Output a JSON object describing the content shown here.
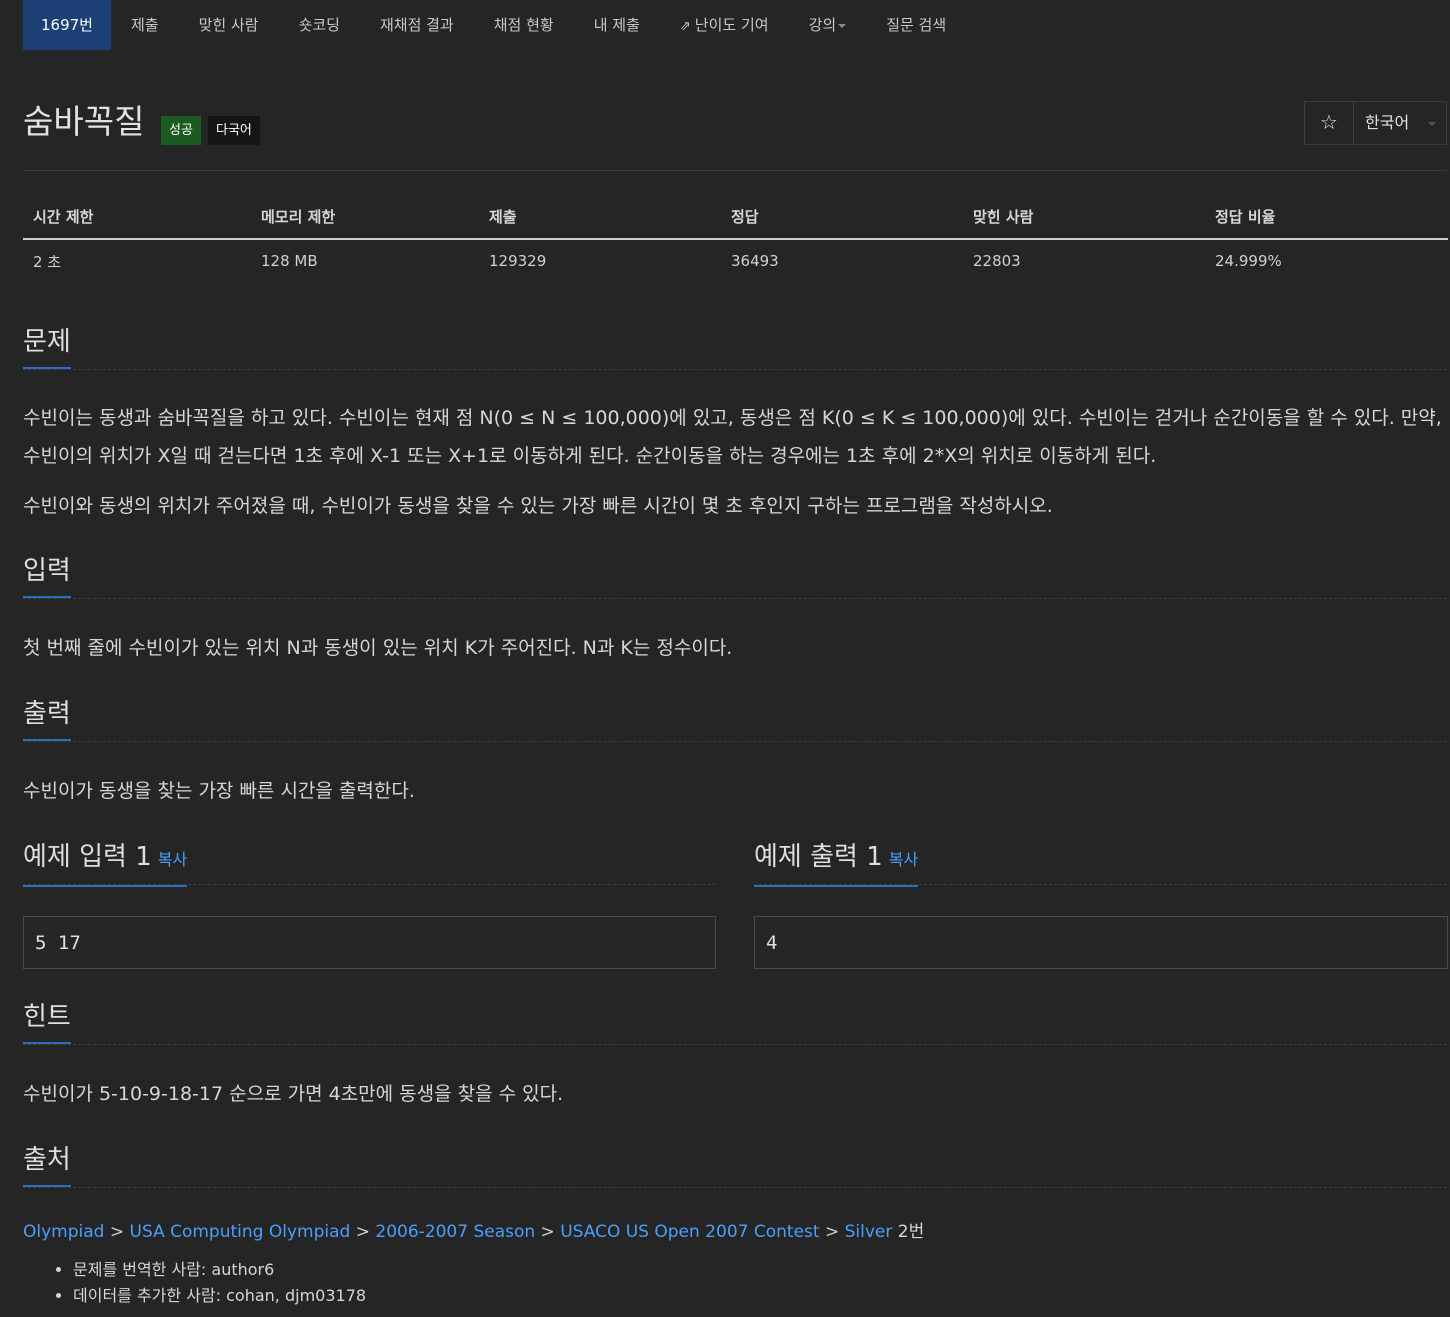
{
  "nav": {
    "items": [
      {
        "label": "1697번"
      },
      {
        "label": "제출"
      },
      {
        "label": "맞힌 사람"
      },
      {
        "label": "숏코딩"
      },
      {
        "label": "재채점 결과"
      },
      {
        "label": "채점 현황"
      },
      {
        "label": "내 제출"
      },
      {
        "label": "난이도 기여"
      },
      {
        "label": "강의"
      },
      {
        "label": "질문 검색"
      }
    ]
  },
  "problem": {
    "title": "숨바꼭질",
    "badge_success": "성공",
    "badge_multilang": "다국어",
    "star_glyph": "☆",
    "language": "한국어"
  },
  "info_table": {
    "headers": [
      "시간 제한",
      "메모리 제한",
      "제출",
      "정답",
      "맞힌 사람",
      "정답 비율"
    ],
    "values": [
      "2 초",
      "128 MB",
      "129329",
      "36493",
      "22803",
      "24.999%"
    ]
  },
  "sections": {
    "problem_heading": "문제",
    "problem_p1": "수빈이는 동생과 숨바꼭질을 하고 있다. 수빈이는 현재 점 N(0 ≤ N ≤ 100,000)에 있고, 동생은 점 K(0 ≤ K ≤ 100,000)에 있다. 수빈이는 걷거나 순간이동을 할 수 있다. 만약, 수빈이의 위치가 X일 때 걷는다면 1초 후에 X-1 또는 X+1로 이동하게 된다. 순간이동을 하는 경우에는 1초 후에 2*X의 위치로 이동하게 된다.",
    "problem_p2": "수빈이와 동생의 위치가 주어졌을 때, 수빈이가 동생을 찾을 수 있는 가장 빠른 시간이 몇 초 후인지 구하는 프로그램을 작성하시오.",
    "input_heading": "입력",
    "input_text": "첫 번째 줄에 수빈이가 있는 위치 N과 동생이 있는 위치 K가 주어진다. N과 K는 정수이다.",
    "output_heading": "출력",
    "output_text": "수빈이가 동생을 찾는 가장 빠른 시간을 출력한다.",
    "sample_input_heading": "예제 입력 1",
    "sample_output_heading": "예제 출력 1",
    "copy_label": "복사",
    "sample_input": "5 17",
    "sample_output": "4",
    "hint_heading": "힌트",
    "hint_text": "수빈이가 5-10-9-18-17 순으로 가면 4초만에 동생을 찾을 수 있다.",
    "source_heading": "출처"
  },
  "source": {
    "crumbs": [
      "Olympiad",
      "USA Computing Olympiad",
      "2006-2007 Season",
      "USACO US Open 2007 Contest",
      "Silver"
    ],
    "separator": ">",
    "suffix": "2번",
    "credits": [
      "문제를 번역한 사람: author6",
      "데이터를 추가한 사람: cohan, djm03178"
    ]
  },
  "colors": {
    "background": "#252525",
    "nav_active": "#1c3f75",
    "accent": "#2a6fc0",
    "link": "#4a9eff",
    "badge_success": "#1d5a22"
  },
  "icons": {
    "star": "star-icon",
    "external_link": "external-link-icon",
    "dropdown": "chevron-down-icon"
  }
}
